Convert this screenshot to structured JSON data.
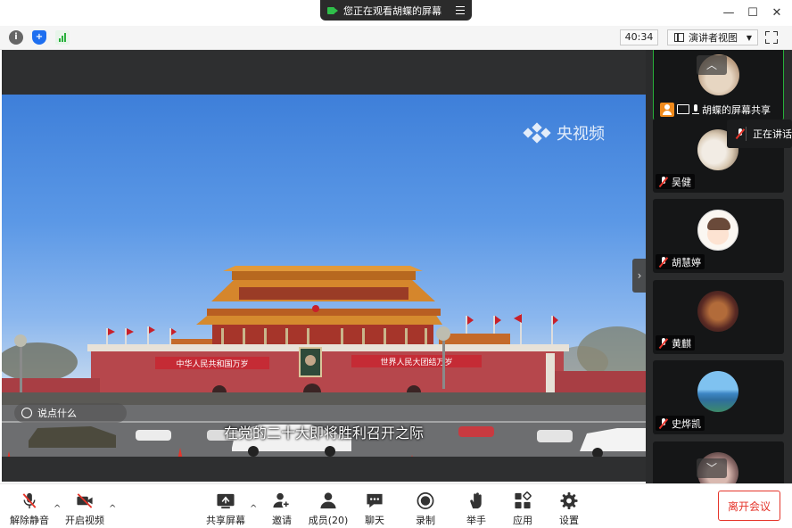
{
  "title_bar": {
    "share_status": "您正在观看胡蝶的屏幕",
    "minimize": "—",
    "maximize": "☐",
    "close": "✕"
  },
  "info_bar": {
    "timer": "40:34",
    "view_mode": "演讲者视图",
    "view_caret": "▼"
  },
  "video": {
    "watermark": "央视频",
    "subtitle": "在党的二十大即将胜利召开之际",
    "comment_placeholder": "说点什么",
    "gate_banner_left": "中华人民共和国万岁",
    "gate_banner_right": "世界人民大团结万岁",
    "collapse_arrow": "›"
  },
  "participants": {
    "scroll_up": "︿",
    "scroll_down": "﹀",
    "screen_share_label": "胡蝶的屏幕共享",
    "speaking_popup": "正在讲话",
    "tiles": [
      {
        "name": "吴健"
      },
      {
        "name": "胡慧婷"
      },
      {
        "name": "黄麒"
      },
      {
        "name": "史烨凯"
      }
    ]
  },
  "toolbar": {
    "unmute": "解除静音",
    "start_video": "开启视频",
    "share_screen": "共享屏幕",
    "invite": "邀请",
    "members": "成员(20)",
    "chat": "聊天",
    "record": "录制",
    "raise_hand": "举手",
    "apps": "应用",
    "settings": "设置",
    "leave": "离开会议",
    "caret": "^"
  },
  "colors": {
    "accent_green": "#27b03a",
    "leave_red": "#e5352b",
    "panel_bg": "#2a2b2c"
  }
}
